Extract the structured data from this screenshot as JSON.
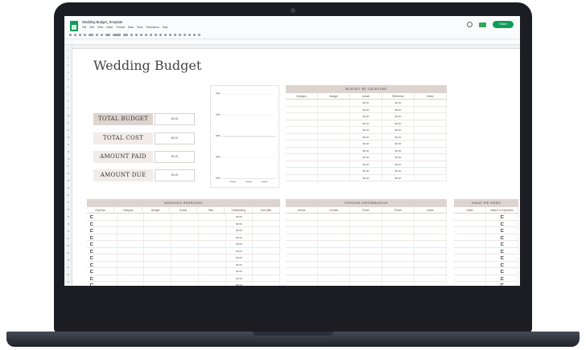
{
  "app": {
    "doc_title": "Wedding Budget_Template",
    "menus": [
      "File",
      "Edit",
      "View",
      "Insert",
      "Format",
      "Data",
      "Tools",
      "Extensions",
      "Help"
    ],
    "share_label": "Share"
  },
  "dashboard": {
    "title": "Wedding Budget",
    "summary": [
      {
        "label": "TOTAL BUDGET",
        "value": "$0.00"
      },
      {
        "label": "TOTAL COST",
        "value": "$0.00"
      },
      {
        "label": "AMOUNT PAID",
        "value": "$0.00"
      },
      {
        "label": "AMOUNT DUE",
        "value": "$0.00"
      }
    ]
  },
  "budget_by_category": {
    "header": "BUDGET BY CATEGORY",
    "columns": [
      "Category",
      "Budget",
      "Actual",
      "Difference",
      "Notes"
    ],
    "rows": [
      [
        "",
        "",
        "$0.00",
        "$0.00",
        ""
      ],
      [
        "",
        "",
        "$0.00",
        "$0.00",
        ""
      ],
      [
        "",
        "",
        "$0.00",
        "$0.00",
        ""
      ],
      [
        "",
        "",
        "$0.00",
        "$0.00",
        ""
      ],
      [
        "",
        "",
        "$0.00",
        "$0.00",
        ""
      ],
      [
        "",
        "",
        "$0.00",
        "$0.00",
        ""
      ],
      [
        "",
        "",
        "$0.00",
        "$0.00",
        ""
      ],
      [
        "",
        "",
        "$0.00",
        "$0.00",
        ""
      ],
      [
        "",
        "",
        "$0.00",
        "$0.00",
        ""
      ],
      [
        "",
        "",
        "$0.00",
        "$0.00",
        ""
      ],
      [
        "",
        "",
        "$0.00",
        "$0.00",
        ""
      ],
      [
        "",
        "",
        "$0.00",
        "$0.00",
        ""
      ]
    ]
  },
  "wedding_expenses": {
    "header": "WEDDING EXPENSES",
    "columns": [
      "Expense",
      "Category",
      "Budget",
      "Actual",
      "Paid",
      "Outstanding",
      "Due Date"
    ],
    "rows": [
      [
        "",
        "",
        "",
        "",
        "",
        "$0.00",
        ""
      ],
      [
        "",
        "",
        "",
        "",
        "",
        "$0.00",
        ""
      ],
      [
        "",
        "",
        "",
        "",
        "",
        "$0.00",
        ""
      ],
      [
        "",
        "",
        "",
        "",
        "",
        "$0.00",
        ""
      ],
      [
        "",
        "",
        "",
        "",
        "",
        "$0.00",
        ""
      ],
      [
        "",
        "",
        "",
        "",
        "",
        "$0.00",
        ""
      ],
      [
        "",
        "",
        "",
        "",
        "",
        "$0.00",
        ""
      ],
      [
        "",
        "",
        "",
        "",
        "",
        "$0.00",
        ""
      ],
      [
        "",
        "",
        "",
        "",
        "",
        "$0.00",
        ""
      ],
      [
        "",
        "",
        "",
        "",
        "",
        "$0.00",
        ""
      ],
      [
        "",
        "",
        "",
        "",
        "",
        "$0.00",
        ""
      ]
    ]
  },
  "vendor_information": {
    "header": "VENDOR INFORMATION",
    "columns": [
      "Vendor",
      "Contact",
      "Email",
      "Phone",
      "Notes"
    ]
  },
  "what_we_need": {
    "header": "WHAT WE NEED",
    "columns": [
      "Detail",
      "Added To Expenses"
    ]
  }
}
